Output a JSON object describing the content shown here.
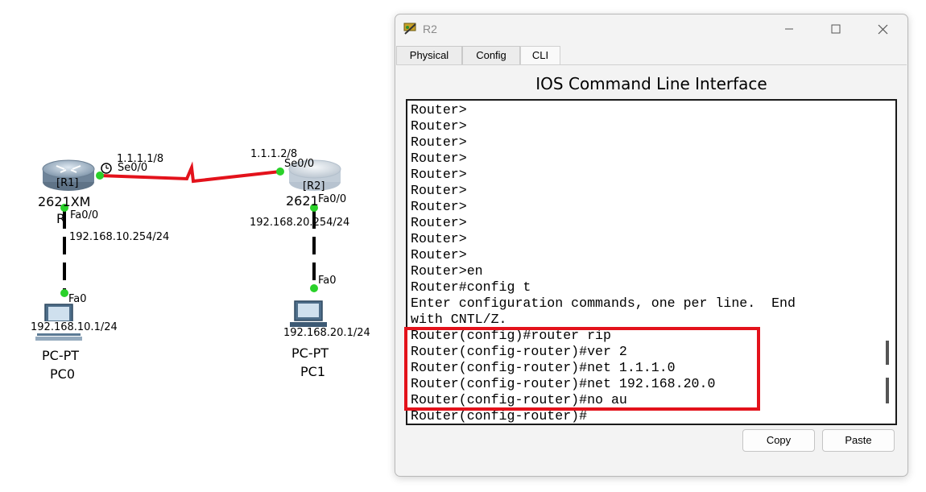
{
  "topology": {
    "links": [
      {
        "name": "serial-link-r1-r2",
        "color": "#e3121b"
      }
    ],
    "r1": {
      "tag": "[R1]",
      "model": "2621XM",
      "model_overlap": "R",
      "serial_ip": "1.1.1.1/8",
      "serial_port": "Se0/0",
      "fa_port": "Fa0/0",
      "fa_ip": "192.168.10.254/24"
    },
    "r2": {
      "tag": "[R2]",
      "model": "2621",
      "serial_ip": "1.1.1.2/8",
      "serial_port": "Se0/0",
      "fa_port": "Fa0/0",
      "fa_ip": "192.168.20.254/24"
    },
    "pc0": {
      "port": "Fa0",
      "ip": "192.168.10.1/24",
      "type": "PC-PT",
      "name": "PC0"
    },
    "pc1": {
      "port": "Fa0",
      "ip": "192.168.20.1/24",
      "type": "PC-PT",
      "name": "PC1"
    }
  },
  "window": {
    "title": "R2",
    "tabs": [
      {
        "label": "Physical"
      },
      {
        "label": "Config"
      },
      {
        "label": "CLI",
        "active": true
      }
    ],
    "heading": "IOS Command Line Interface",
    "terminal_lines": [
      "Router>",
      "Router>",
      "Router>",
      "Router>",
      "Router>",
      "Router>",
      "Router>",
      "Router>",
      "Router>",
      "Router>",
      "Router>en",
      "Router#config t",
      "Enter configuration commands, one per line.  End",
      "with CNTL/Z.",
      "Router(config)#router rip",
      "Router(config-router)#ver 2",
      "Router(config-router)#net 1.1.1.0",
      "Router(config-router)#net 192.168.20.0",
      "Router(config-router)#no au",
      "Router(config-router)#"
    ],
    "buttons": {
      "copy": "Copy",
      "paste": "Paste"
    },
    "highlight_color": "#e3121b"
  }
}
